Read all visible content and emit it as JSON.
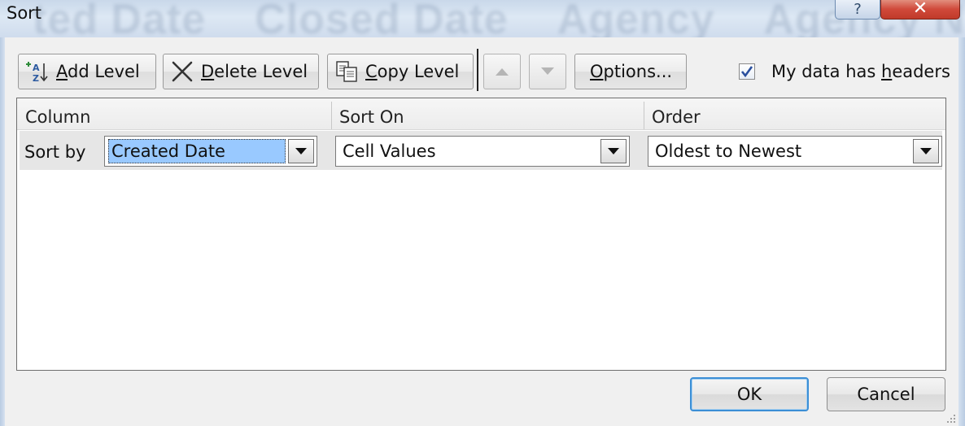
{
  "window": {
    "title": "Sort",
    "background_headers": [
      "ted Date",
      "Closed Date",
      "Agency",
      "Agency N"
    ],
    "help_glyph": "?",
    "close_glyph": "✕"
  },
  "toolbar": {
    "add_level": {
      "pre": "",
      "key": "A",
      "post": "dd Level"
    },
    "delete_level": {
      "pre": "",
      "key": "D",
      "post": "elete Level"
    },
    "copy_level": {
      "pre": "",
      "key": "C",
      "post": "opy Level"
    },
    "options": {
      "pre": "",
      "key": "O",
      "post": "ptions..."
    },
    "headers_checkbox": {
      "pre": "My data has ",
      "key": "h",
      "post": "eaders",
      "checked": true
    }
  },
  "grid": {
    "columns": [
      "Column",
      "Sort On",
      "Order"
    ],
    "rows": [
      {
        "label": "Sort by",
        "column": "Created Date",
        "sort_on": "Cell Values",
        "order": "Oldest to Newest"
      }
    ]
  },
  "footer": {
    "ok": "OK",
    "cancel": "Cancel"
  },
  "icons": {
    "add_level": "sort-az-add-icon",
    "delete_level": "x-delete-icon",
    "copy_level": "copy-pages-icon",
    "move_up": "triangle-up-icon",
    "move_down": "triangle-down-icon"
  },
  "colors": {
    "selection": "#99c9ff",
    "default_button_border": "#3c8fd6",
    "close_button": "#d0493a",
    "checkbox_mark": "#2a4f9e"
  }
}
